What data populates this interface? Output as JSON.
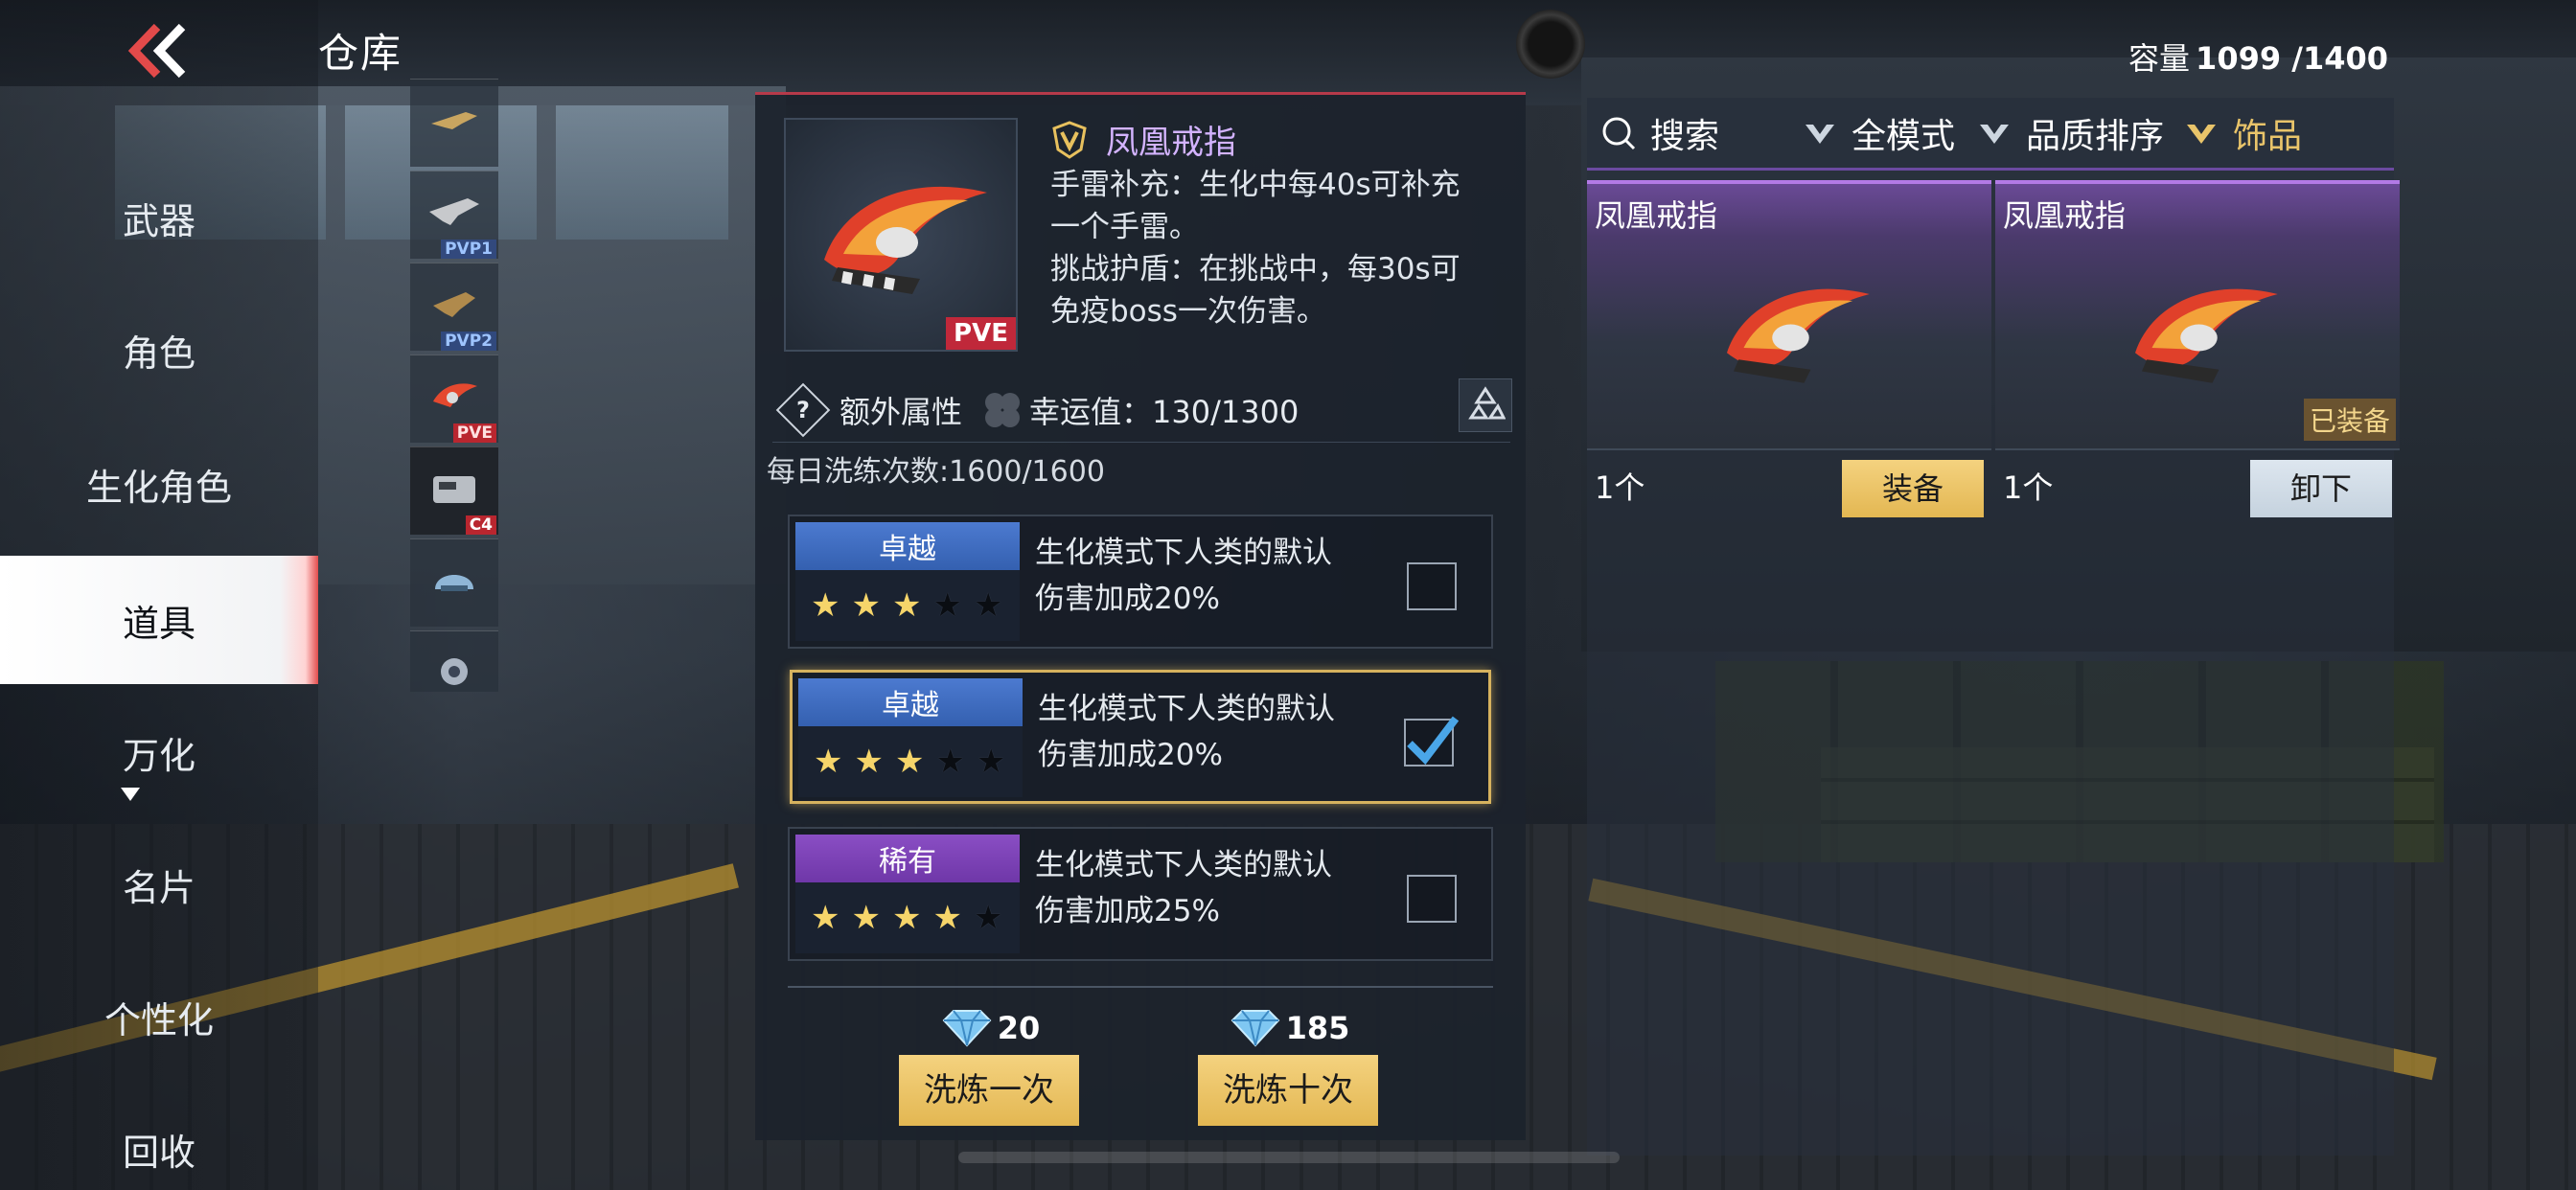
{
  "header": {
    "title": "仓库",
    "capacity_label": "容量",
    "capacity_value": "1099 /1400"
  },
  "nav": {
    "items": [
      {
        "label": "武器"
      },
      {
        "label": "角色"
      },
      {
        "label": "生化角色"
      },
      {
        "label": "道具"
      },
      {
        "label": "万化"
      },
      {
        "label": "名片"
      },
      {
        "label": "个性化"
      },
      {
        "label": "回收"
      }
    ],
    "active_index": 3
  },
  "thumbnails": [
    {
      "tag": ""
    },
    {
      "tag": "PVP1"
    },
    {
      "tag": "PVP2"
    },
    {
      "tag": "PVE"
    },
    {
      "tag": "C4"
    },
    {
      "tag": ""
    },
    {
      "tag": ""
    }
  ],
  "detail": {
    "item_name": "凤凰戒指",
    "item_tag": "PVE",
    "description_lines": [
      "手雷补充：生化中每40s可补充",
      "一个手雷。",
      "挑战护盾：在挑战中，每30s可",
      "免疫boss一次伤害。"
    ],
    "extra_label": "额外属性",
    "luck_label": "幸运值：",
    "luck_value": "130/1300",
    "daily_label": "每日洗练次数:1600/1600",
    "attributes": [
      {
        "quality": "卓越",
        "stars": 3,
        "max_stars": 5,
        "line1": "生化模式下人类的默认",
        "line2": "伤害加成20%",
        "checked": false
      },
      {
        "quality": "卓越",
        "stars": 3,
        "max_stars": 5,
        "line1": "生化模式下人类的默认",
        "line2": "伤害加成20%",
        "checked": true
      },
      {
        "quality": "稀有",
        "stars": 4,
        "max_stars": 5,
        "line1": "生化模式下人类的默认",
        "line2": "伤害加成25%",
        "checked": false
      }
    ],
    "refine_once": {
      "cost": "20",
      "label": "洗炼一次"
    },
    "refine_ten": {
      "cost": "185",
      "label": "洗炼十次"
    }
  },
  "inventory": {
    "search_label": "搜索",
    "mode_label": "全模式",
    "sort_label": "品质排序",
    "category_label": "饰品",
    "items": [
      {
        "name": "凤凰戒指",
        "count": "1个",
        "action": "装备",
        "equipped_label": ""
      },
      {
        "name": "凤凰戒指",
        "count": "1个",
        "action": "卸下",
        "equipped_label": "已装备"
      }
    ]
  },
  "colors": {
    "accent_gold": "#e3b752",
    "quality_excellent": "#4c7ad0",
    "quality_rare": "#8a4ec4",
    "active_nav_edge": "#e34c4c"
  }
}
